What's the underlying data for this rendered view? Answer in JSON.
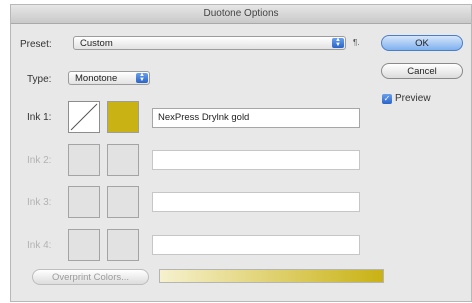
{
  "dialog": {
    "title": "Duotone Options"
  },
  "preset": {
    "label": "Preset:",
    "value": "Custom",
    "menu_icon": "menu-expand-icon"
  },
  "type": {
    "label": "Type:",
    "value": "Monotone"
  },
  "inks": [
    {
      "label": "Ink 1:",
      "name": "NexPress Drylnk gold",
      "color": "#c9b213",
      "enabled": true
    },
    {
      "label": "Ink 2:",
      "name": "",
      "enabled": false
    },
    {
      "label": "Ink 3:",
      "name": "",
      "enabled": false
    },
    {
      "label": "Ink 4:",
      "name": "",
      "enabled": false
    }
  ],
  "buttons": {
    "ok": "OK",
    "cancel": "Cancel",
    "overprint": "Overprint Colors..."
  },
  "preview": {
    "label": "Preview",
    "checked": true
  },
  "ramp": {
    "from": "#f6f1cf",
    "to": "#c9b213"
  }
}
